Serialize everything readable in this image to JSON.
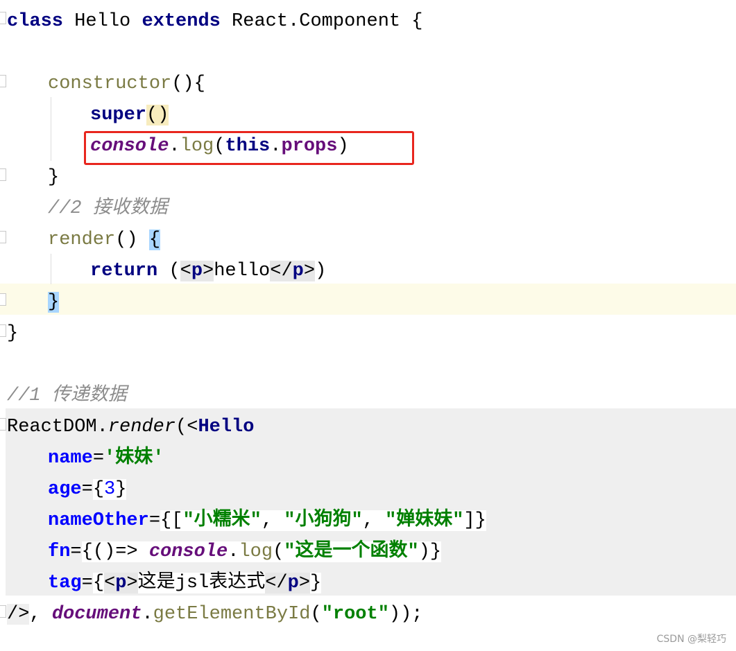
{
  "code": {
    "l1": {
      "kw1": "class",
      "name": " Hello ",
      "kw2": "extends",
      "rest": " React.Component {"
    },
    "l3": {
      "fn": "constructor",
      "rest": "(){"
    },
    "l4": {
      "kw": "super",
      "paren": "()"
    },
    "l5": {
      "obj": "console",
      "dot": ".",
      "method": "log",
      "open": "(",
      "this": "this",
      "dot2": ".",
      "prop": "props",
      "close": ")"
    },
    "l6": {
      "brace": "}"
    },
    "l7": {
      "comment": "//2 接收数据"
    },
    "l8": {
      "fn": "render",
      "paren": "() ",
      "brace": "{"
    },
    "l9": {
      "kw": "return",
      "space": " (",
      "lt": "<",
      "tag": "p",
      "gt": ">",
      "text": "hello",
      "lt2": "</",
      "tag2": "p",
      "gt2": ">",
      "close": ")"
    },
    "l10": {
      "brace": "}"
    },
    "l11": {
      "brace": "}"
    },
    "l13": {
      "comment": "//1 传递数据"
    },
    "l14": {
      "obj": "ReactDOM",
      "dot": ".",
      "method": "render",
      "open": "(",
      "lt": "<",
      "tag": "Hello"
    },
    "l15": {
      "attr": "name",
      "eq": "=",
      "val": "'妹妹'"
    },
    "l16": {
      "attr": "age",
      "eq": "=",
      "open": "{",
      "val": "3",
      "close": "}"
    },
    "l17": {
      "attr": "nameOther",
      "eq": "=",
      "open": "{[",
      "s1": "\"小糯米\"",
      "c1": ", ",
      "s2": "\"小狗狗\"",
      "c2": ", ",
      "s3": "\"婵妹妹\"",
      "close": "]}"
    },
    "l18": {
      "attr": "fn",
      "eq": "=",
      "open": "{()=> ",
      "obj": "console",
      "dot": ".",
      "method": "log",
      "p1": "(",
      "str": "\"这是一个函数\"",
      "close": ")}"
    },
    "l19": {
      "attr": "tag",
      "eq": "=",
      "open": "{",
      "lt": "<",
      "tag": "p",
      "gt": ">",
      "text": "这是jsl表达式",
      "lt2": "</",
      "tag2": "p",
      "gt2": ">",
      "close": "}"
    },
    "l20": {
      "end": "/>",
      "comma": ", ",
      "obj": "document",
      "dot": ".",
      "method": "getElementById",
      "open": "(",
      "str": "\"root\"",
      "close": "));"
    }
  },
  "watermark": "CSDN @梨轻巧"
}
